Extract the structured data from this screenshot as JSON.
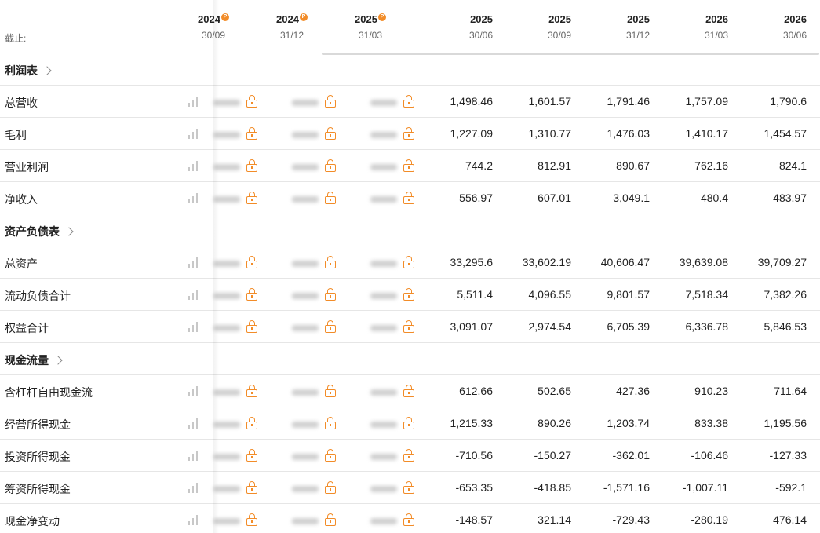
{
  "header": {
    "as_of_label": "截止:",
    "columns": [
      {
        "year": "2024",
        "date": "30/09",
        "locked": true
      },
      {
        "year": "2024",
        "date": "31/12",
        "locked": true
      },
      {
        "year": "2025",
        "date": "31/03",
        "locked": true
      },
      {
        "year": "2025",
        "date": "30/06",
        "locked": false
      },
      {
        "year": "2025",
        "date": "30/09",
        "locked": false
      },
      {
        "year": "2025",
        "date": "31/12",
        "locked": false
      },
      {
        "year": "2026",
        "date": "31/03",
        "locked": false
      },
      {
        "year": "2026",
        "date": "30/06",
        "locked": false
      }
    ],
    "pro_badge": "P"
  },
  "colors": {
    "accent": "#f28c28",
    "border": "#e6e6e6",
    "muted": "#666666"
  },
  "rows": [
    {
      "type": "section",
      "label": "利润表"
    },
    {
      "type": "data",
      "label": "总营收",
      "values": [
        "1,498.46",
        "1,601.57",
        "1,791.46",
        "1,757.09",
        "1,790.6"
      ]
    },
    {
      "type": "data",
      "label": "毛利",
      "values": [
        "1,227.09",
        "1,310.77",
        "1,476.03",
        "1,410.17",
        "1,454.57"
      ]
    },
    {
      "type": "data",
      "label": "营业利润",
      "values": [
        "744.2",
        "812.91",
        "890.67",
        "762.16",
        "824.1"
      ]
    },
    {
      "type": "data",
      "label": "净收入",
      "values": [
        "556.97",
        "607.01",
        "3,049.1",
        "480.4",
        "483.97"
      ]
    },
    {
      "type": "section",
      "label": "资产负债表"
    },
    {
      "type": "data",
      "label": "总资产",
      "values": [
        "33,295.6",
        "33,602.19",
        "40,606.47",
        "39,639.08",
        "39,709.27"
      ]
    },
    {
      "type": "data",
      "label": "流动负债合计",
      "values": [
        "5,511.4",
        "4,096.55",
        "9,801.57",
        "7,518.34",
        "7,382.26"
      ]
    },
    {
      "type": "data",
      "label": "权益合计",
      "values": [
        "3,091.07",
        "2,974.54",
        "6,705.39",
        "6,336.78",
        "5,846.53"
      ]
    },
    {
      "type": "section",
      "label": "现金流量"
    },
    {
      "type": "data",
      "label": "含杠杆自由现金流",
      "values": [
        "612.66",
        "502.65",
        "427.36",
        "910.23",
        "711.64"
      ]
    },
    {
      "type": "data",
      "label": "经营所得现金",
      "values": [
        "1,215.33",
        "890.26",
        "1,203.74",
        "833.38",
        "1,195.56"
      ]
    },
    {
      "type": "data",
      "label": "投资所得现金",
      "values": [
        "-710.56",
        "-150.27",
        "-362.01",
        "-106.46",
        "-127.33"
      ]
    },
    {
      "type": "data",
      "label": "筹资所得现金",
      "values": [
        "-653.35",
        "-418.85",
        "-1,571.16",
        "-1,007.11",
        "-592.1"
      ]
    },
    {
      "type": "data",
      "label": "现金净变动",
      "values": [
        "-148.57",
        "321.14",
        "-729.43",
        "-280.19",
        "476.14"
      ]
    }
  ]
}
